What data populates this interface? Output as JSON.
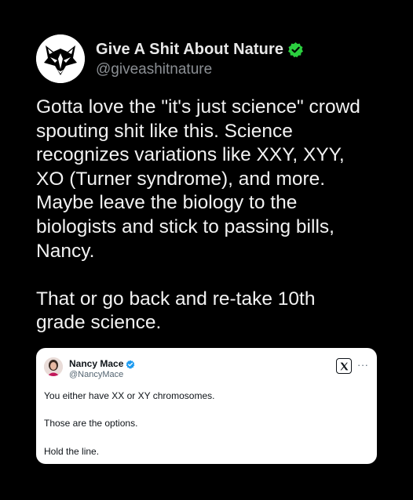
{
  "author": {
    "display_name": "Give A Shit About Nature",
    "handle": "@giveashitnature",
    "verified": true,
    "verified_icon": "verified-badge-icon",
    "verified_color": "#2bcf3f",
    "avatar_icon": "wolf-head-logo-icon"
  },
  "tweet": {
    "text": "Gotta love the \"it's just science\" crowd\nspouting shit like this. Science\nrecognizes variations like XXY, XYY,\nXO (Turner syndrome), and more.\nMaybe leave the biology to the\nbiologists and stick to passing bills,\nNancy.\n\nThat or go back and re-take 10th\ngrade science."
  },
  "quoted_post": {
    "display_name": "Nancy Mace",
    "handle": "@NancyMace",
    "verified": true,
    "verified_icon": "verified-badge-icon",
    "verified_color": "#1d9bf0",
    "lines": [
      "You either have XX or XY chromosomes.",
      "Those are the options.",
      "Hold the line."
    ],
    "x_logo_icon": "x-logo-icon",
    "more_label": "···"
  }
}
